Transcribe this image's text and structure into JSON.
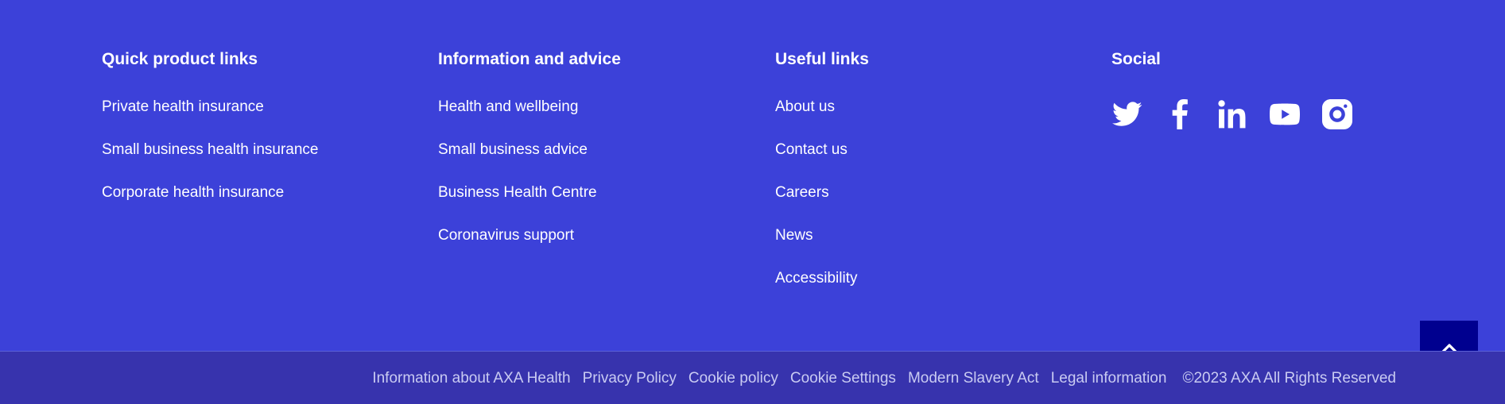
{
  "columns": {
    "quick_links": {
      "title": "Quick product links",
      "items": [
        "Private health insurance",
        "Small business health insurance",
        "Corporate health insurance"
      ]
    },
    "info_advice": {
      "title": "Information and advice",
      "items": [
        "Health and wellbeing",
        "Small business advice",
        "Business Health Centre",
        "Coronavirus support"
      ]
    },
    "useful_links": {
      "title": "Useful links",
      "items": [
        "About us",
        "Contact us",
        "Careers",
        "News",
        "Accessibility"
      ]
    },
    "social": {
      "title": "Social",
      "icons": [
        "twitter-icon",
        "facebook-icon",
        "linkedin-icon",
        "youtube-icon",
        "instagram-icon"
      ]
    }
  },
  "back_to_top": {
    "icon": "chevron-up-icon"
  },
  "legal": {
    "links": [
      "Information about AXA Health",
      "Privacy Policy",
      "Cookie policy",
      "Cookie Settings",
      "Modern Slavery Act",
      "Legal information"
    ],
    "copyright": "©2023 AXA All Rights Reserved"
  },
  "colors": {
    "background": "#3c41d9",
    "bottom_bar": "#3733ad",
    "back_to_top": "#00008f",
    "legal_text": "#c9cbf2"
  }
}
